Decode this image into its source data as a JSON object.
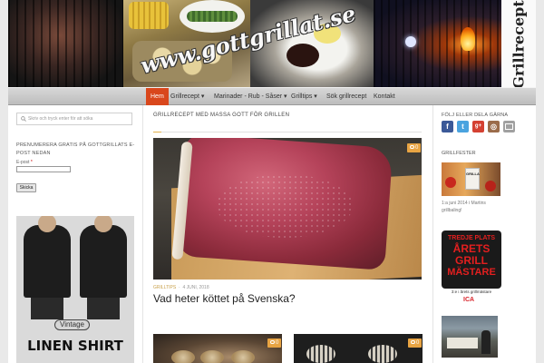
{
  "header": {
    "logo_text": "www.gottgrillat.se",
    "side_title": "Grillrecept"
  },
  "nav": {
    "items": [
      {
        "label": "Hem",
        "active": true
      },
      {
        "label": "Grillrecept ▾",
        "active": false
      },
      {
        "label": "Marinader - Rub - Såser ▾",
        "active": false
      },
      {
        "label": "Grilltips ▾",
        "active": false
      },
      {
        "label": "Sök grillrecept",
        "active": false
      },
      {
        "label": "Kontakt",
        "active": false
      }
    ]
  },
  "left_sidebar": {
    "search_placeholder": "Skriv och tryck enter för att söka",
    "subscribe_title": "PRENUMERERA GRATIS PÅ GOTTGRILLATS E-POST NEDAN",
    "email_label": "E-post",
    "required_mark": "*",
    "submit_label": "Skicka",
    "ad": {
      "pill_text": "Vintage",
      "headline": "LINEN SHIRT"
    }
  },
  "main": {
    "heading": "GRILLRECEPT MED MASSA GOTT FÖR GRILLEN",
    "featured_post": {
      "comment_count": "0",
      "category": "GRILLTIPS",
      "date": "4 JUNI, 2018",
      "title": "Vad heter köttet på Svenska?"
    },
    "more_posts": [
      {
        "comment_count": "0"
      },
      {
        "comment_count": "0"
      }
    ]
  },
  "right_sidebar": {
    "follow_title": "FÖLJ ELLER DELA GÄRNA",
    "social": [
      {
        "label": "f",
        "icon": "facebook-icon",
        "color": "#3b5998"
      },
      {
        "label": "t",
        "icon": "twitter-icon",
        "color": "#4aa3df"
      },
      {
        "label": "g+",
        "icon": "google-plus-icon",
        "color": "#d44132"
      },
      {
        "label": "◎",
        "icon": "instagram-icon",
        "color": "#9b6c4a"
      },
      {
        "label": "",
        "icon": "email-icon",
        "color": "#a0a0a0"
      }
    ],
    "grillfester_title": "GRILLFESTER",
    "grillfester_card_text": "GRILLA",
    "grillfester_caption": "1:a juni 2014 i Martins grillbaling!",
    "award": {
      "line1": "TREDJE PLATS",
      "line2": "ÅRETS",
      "line3": "GRILL",
      "line4": "MÄSTARE",
      "caption": "3:e i årets grillmästare",
      "sponsor": "ICA"
    }
  },
  "colors": {
    "accent": "#d9471c",
    "badge": "#e8a443",
    "award_red": "#e41f1f"
  }
}
